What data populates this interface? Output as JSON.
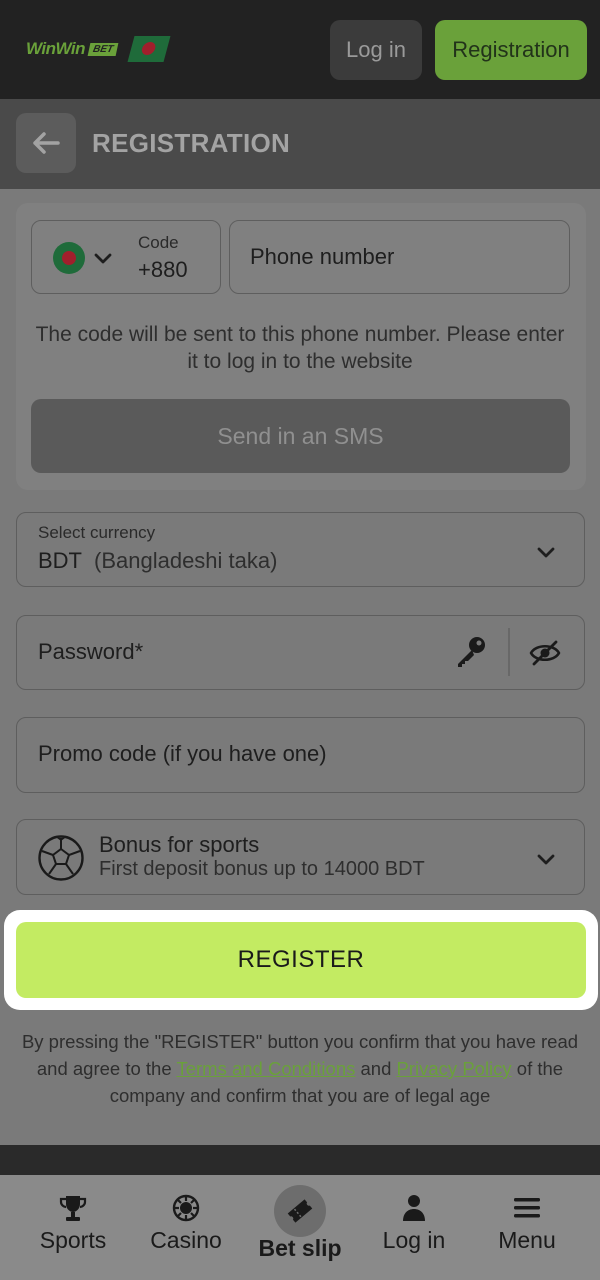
{
  "header": {
    "logo_text": "WinWin",
    "logo_badge": "BET",
    "login_label": "Log in",
    "registration_label": "Registration"
  },
  "titlebar": {
    "title": "REGISTRATION"
  },
  "phone": {
    "code_label": "Code",
    "code_value": "+880",
    "phone_placeholder": "Phone number",
    "hint": "The code will be sent to this phone number. Please enter it to log in to the website",
    "sms_button": "Send in an SMS"
  },
  "currency": {
    "label": "Select currency",
    "code": "BDT",
    "name": "(Bangladeshi taka)"
  },
  "password": {
    "placeholder": "Password*"
  },
  "promo": {
    "placeholder": "Promo code (if you have one)"
  },
  "bonus": {
    "title": "Bonus for sports",
    "subtitle": "First deposit bonus up to 14000 BDT"
  },
  "register": {
    "label": "REGISTER"
  },
  "legal": {
    "part1": "By pressing the \"REGISTER\" button you confirm that you have read and agree to the ",
    "terms_link": "Terms and Conditions",
    "and": " and ",
    "privacy_link": "Privacy Policy",
    "part2": " of the company and confirm that you are of legal age"
  },
  "nav": {
    "sports": "Sports",
    "casino": "Casino",
    "bet_slip": "Bet slip",
    "login": "Log in",
    "menu": "Menu"
  },
  "colors": {
    "accent_green": "#6aa13a",
    "register_green": "#c3eb62",
    "header_bg": "#222222"
  }
}
